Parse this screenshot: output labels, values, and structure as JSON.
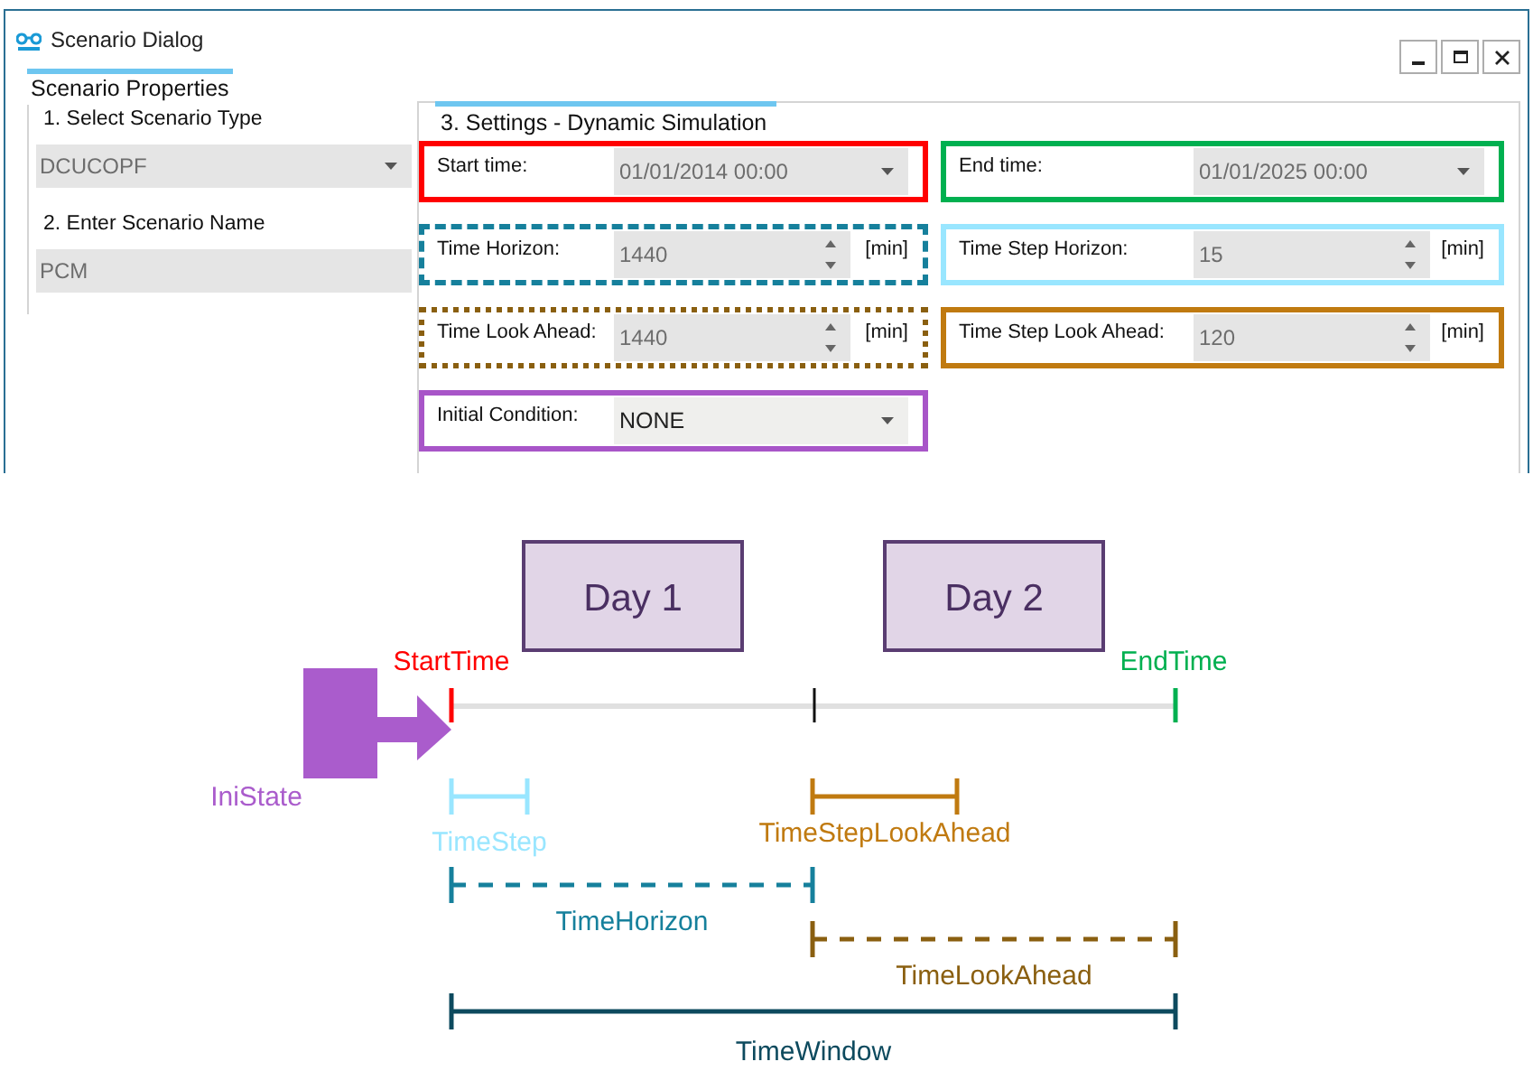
{
  "window": {
    "title": "Scenario Dialog"
  },
  "left_panel": {
    "tab": "Scenario Properties",
    "steps": [
      {
        "label": "1. Select Scenario Type",
        "kind": "dropdown",
        "value": "DCUCOPF"
      },
      {
        "label": "2. Enter Scenario Name",
        "kind": "text",
        "value": "PCM"
      }
    ]
  },
  "settings": {
    "title": "3. Settings - Dynamic Simulation",
    "fields": [
      {
        "label": "Start time:",
        "kind": "dropdown",
        "value": "01/01/2014 00:00",
        "color": "#ff0000",
        "dashed": false,
        "dotted": false,
        "disabled": true
      },
      {
        "label": "End time:",
        "kind": "dropdown",
        "value": "01/01/2025 00:00",
        "color": "#00b050",
        "dashed": false,
        "dotted": false,
        "disabled": true
      },
      {
        "label": "Time Horizon:",
        "kind": "spinner",
        "value": "1440",
        "unit": "[min]",
        "color": "#16809c",
        "dashed": true,
        "dotted": false,
        "disabled": true
      },
      {
        "label": "Time Step Horizon:",
        "kind": "spinner",
        "value": "15",
        "unit": "[min]",
        "color": "#99e6ff",
        "dashed": false,
        "dotted": false,
        "disabled": true
      },
      {
        "label": "Time Look Ahead:",
        "kind": "spinner",
        "value": "1440",
        "unit": "[min]",
        "color": "#8a5f10",
        "dashed": false,
        "dotted": true,
        "disabled": true
      },
      {
        "label": "Time Step Look Ahead:",
        "kind": "spinner",
        "value": "120",
        "unit": "[min]",
        "color": "#c07a10",
        "dashed": false,
        "dotted": false,
        "disabled": true
      },
      {
        "label": "Initial Condition:",
        "kind": "dropdown",
        "value": "NONE",
        "color": "#a855c8",
        "dashed": false,
        "dotted": false,
        "disabled": false
      }
    ]
  },
  "diagram": {
    "days": [
      "Day 1",
      "Day 2"
    ],
    "markers": [
      {
        "label": "StartTime",
        "color": "#ff0000"
      },
      {
        "label": "EndTime",
        "color": "#00b050"
      }
    ],
    "initial_state": {
      "label": "IniState",
      "color": "#aa5ccc"
    },
    "spans": [
      {
        "label": "TimeStep",
        "color": "#99e6ff",
        "dashed": false
      },
      {
        "label": "TimeStepLookAhead",
        "color": "#c07a10",
        "dashed": false
      },
      {
        "label": "TimeHorizon",
        "color": "#16809c",
        "dashed": true
      },
      {
        "label": "TimeLookAhead",
        "color": "#8a5f10",
        "dashed": true
      },
      {
        "label": "TimeWindow",
        "color": "#0d4a5e",
        "dashed": false
      }
    ]
  }
}
